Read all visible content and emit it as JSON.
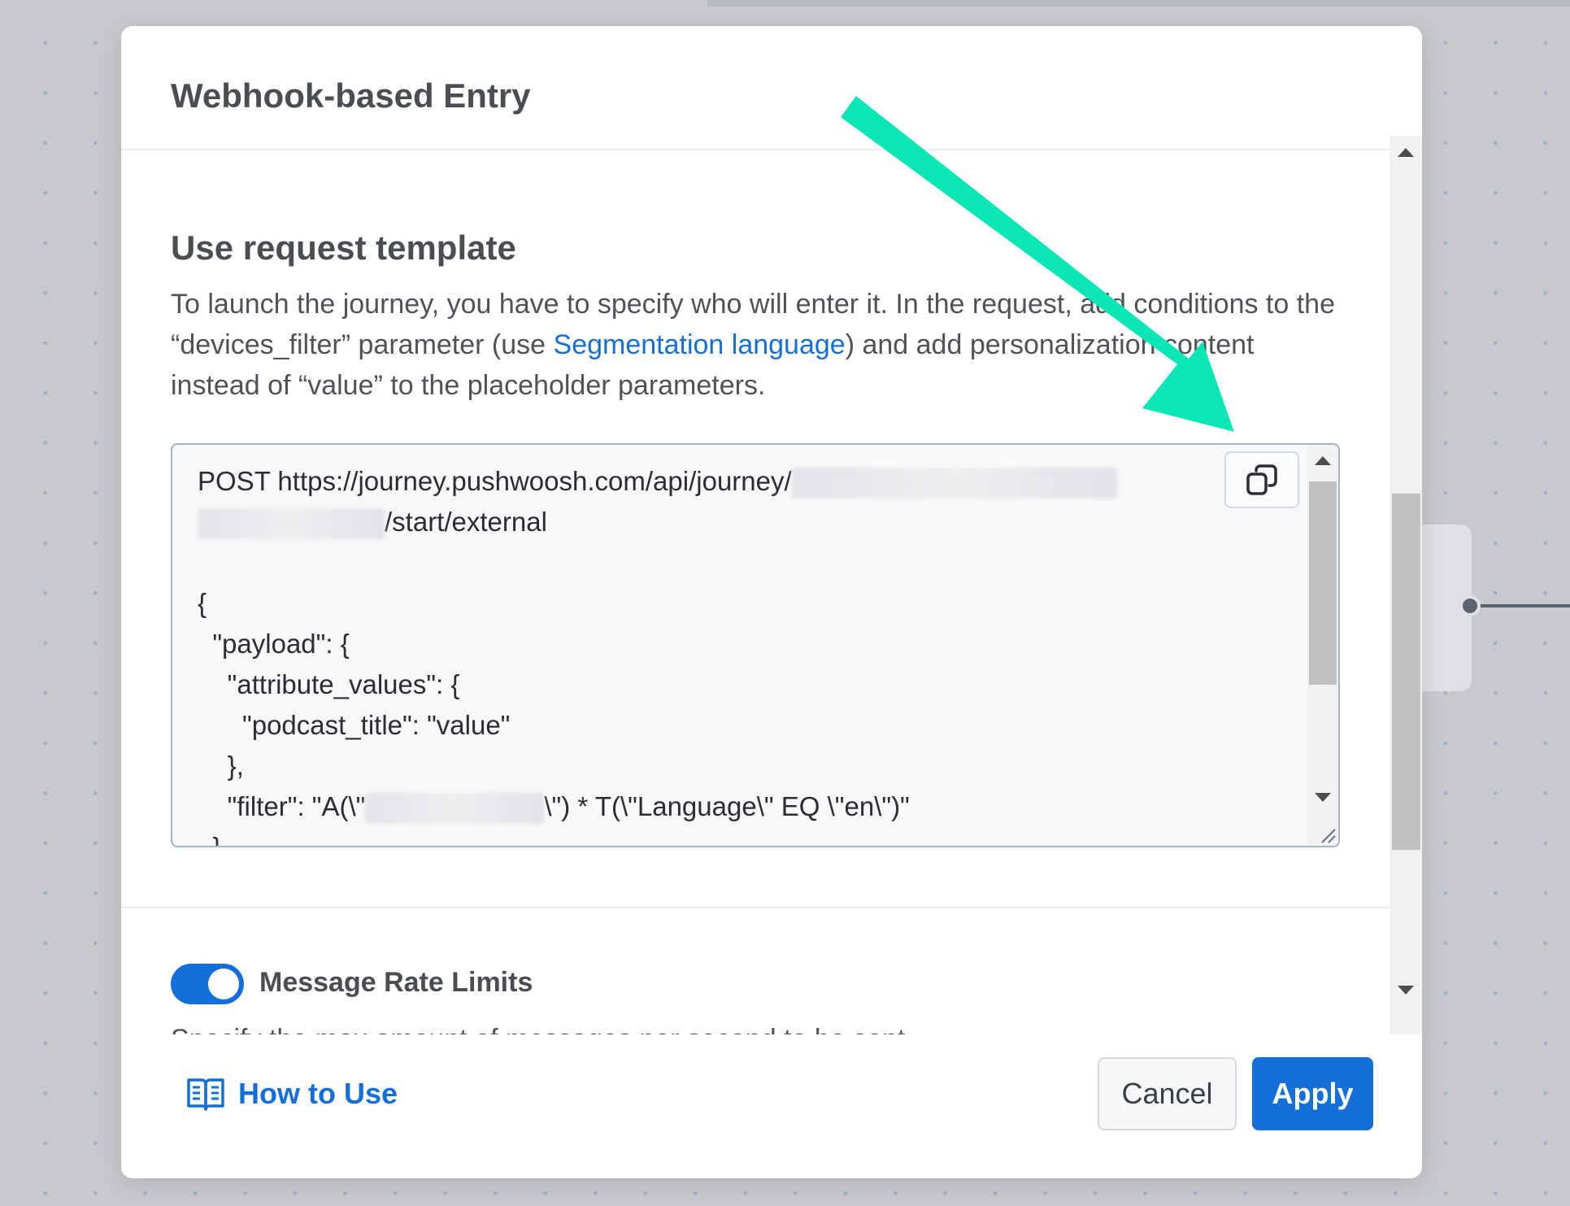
{
  "modal": {
    "title": "Webhook-based Entry"
  },
  "template_section": {
    "heading": "Use request template",
    "desc_part1": "To launch the journey, you have to specify who will enter it. In the request, add conditions to the “devices_filter” parameter (use ",
    "desc_link": "Segmentation language",
    "desc_part2": ") and add personalization content instead of “value” to the placeholder parameters."
  },
  "code": {
    "line1_prefix": "POST https://journey.pushwoosh.com/api/journey/",
    "line2_suffix": "/start/external",
    "body_lines": [
      "",
      "{",
      "  \"payload\": {",
      "    \"attribute_values\": {",
      "      \"podcast_title\": \"value\"",
      "    },"
    ],
    "filter_prefix": "    \"filter\": \"A(\\\"",
    "filter_suffix": "\\\") * T(\\\"Language\\\" EQ \\\"en\\\")\"",
    "cut_line": "  }",
    "copy_icon": "copy-icon"
  },
  "rate_limits": {
    "label": "Message Rate Limits",
    "enabled": true,
    "cut_text": "Specify the max amount of messages per second to be sent"
  },
  "footer": {
    "how_to_use": "How to Use",
    "how_to_use_icon": "book-icon",
    "cancel": "Cancel",
    "apply": "Apply"
  },
  "colors": {
    "accent": "#1470d8",
    "annotation_arrow": "#0be6b5"
  }
}
